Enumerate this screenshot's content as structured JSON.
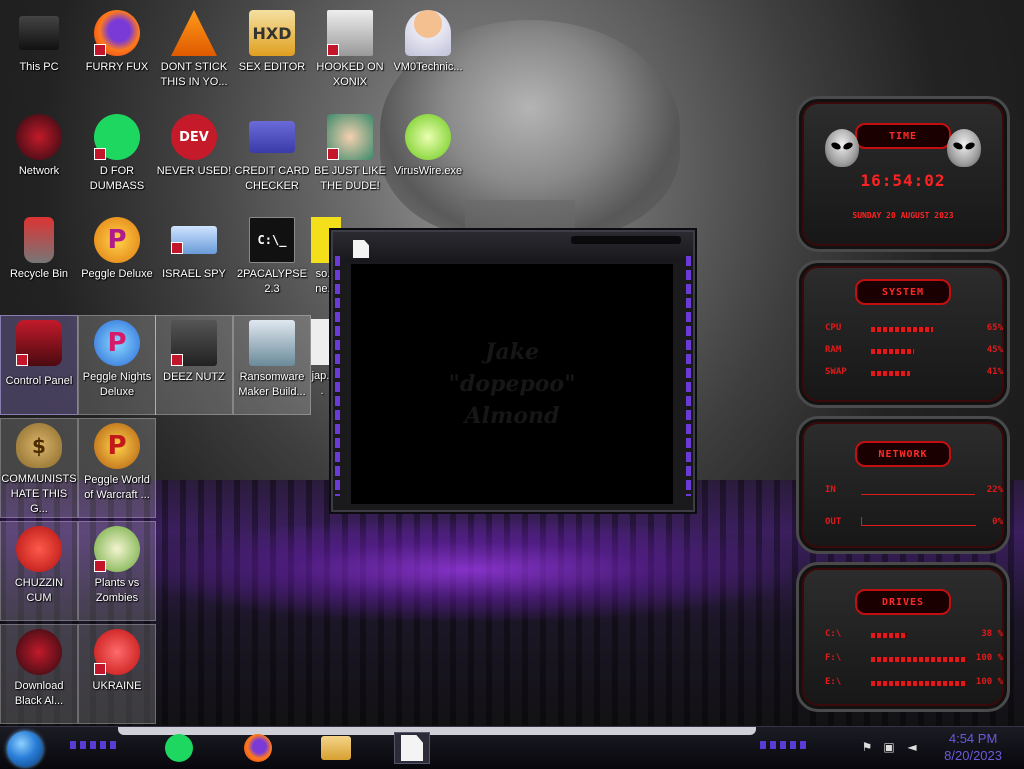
{
  "desktop": {
    "icons": [
      {
        "label": "This PC"
      },
      {
        "label": "FURRY FUX"
      },
      {
        "label": "DONT STICK THIS IN YO..."
      },
      {
        "label": "SEX EDITOR"
      },
      {
        "label": "HOOKED ON XONIX"
      },
      {
        "label": "VM0Technic..."
      },
      {
        "label": "Network"
      },
      {
        "label": "D FOR DUMBASS"
      },
      {
        "label": "NEVER USED!"
      },
      {
        "label": "CREDIT CARD CHECKER"
      },
      {
        "label": "BE JUST LIKE THE DUDE!"
      },
      {
        "label": "VirusWire.exe"
      },
      {
        "label": "Recycle Bin"
      },
      {
        "label": "Peggle Deluxe"
      },
      {
        "label": "ISRAEL SPY"
      },
      {
        "label": "2PACALYPSE 2.3"
      },
      {
        "label": "so... ne..."
      },
      {
        "label": "Control Panel"
      },
      {
        "label": "Peggle Nights Deluxe"
      },
      {
        "label": "DEEZ NUTZ"
      },
      {
        "label": "Ransomware Maker Build..."
      },
      {
        "label": "jap..."
      },
      {
        "label": "COMMUNISTS HATE THIS G..."
      },
      {
        "label": "Peggle World of Warcraft ..."
      },
      {
        "label": "CHUZZIN CUM"
      },
      {
        "label": "Plants vs Zombies"
      },
      {
        "label": "Download Black Al..."
      },
      {
        "label": "UKRAINE"
      }
    ],
    "glyphs": {
      "firefox": "●",
      "dev": "DEV",
      "cmd": "C:\\_",
      "peggle": "P",
      "money": "$"
    }
  },
  "window": {
    "text_line1": "Jake",
    "text_line2": "\"dopepoo\"",
    "text_line3": "Almond"
  },
  "widget": {
    "time_title": "TIME",
    "clock": "16:54:02",
    "date": "SUNDAY 20 AUGUST 2023",
    "system_title": "SYSTEM",
    "cpu_label": "CPU",
    "cpu_value": "65%",
    "cpu_frac": 0.65,
    "ram_label": "RAM",
    "ram_value": "45%",
    "ram_frac": 0.45,
    "swap_label": "SWAP",
    "swap_value": "41%",
    "swap_frac": 0.41,
    "network_title": "NETWORK",
    "in_label": "IN",
    "in_value": "22%",
    "out_label": "OUT",
    "out_value": "0%",
    "drives_title": "DRIVES",
    "drive_c_label": "C:\\",
    "drive_c_value": "38 %",
    "drive_c_frac": 0.38,
    "drive_f_label": "F:\\",
    "drive_f_value": "100 %",
    "drive_f_frac": 1.0,
    "drive_e_label": "E:\\",
    "drive_e_value": "100 %",
    "drive_e_frac": 1.0
  },
  "taskbar": {
    "time": "4:54 PM",
    "date": "8/20/2023"
  },
  "colors": {
    "accent_red": "#e01a1a",
    "accent_purple": "#6b3bd8",
    "clock_blue": "#6a5bd8"
  }
}
